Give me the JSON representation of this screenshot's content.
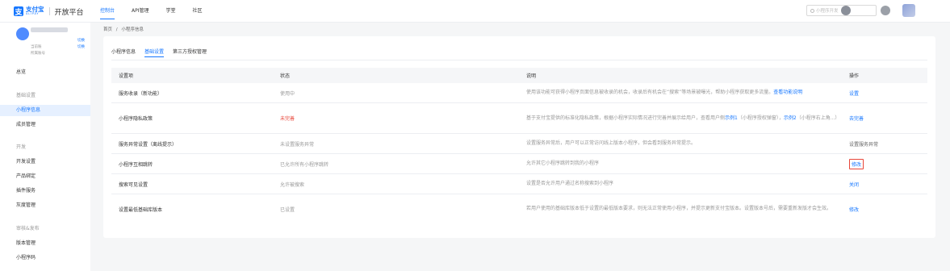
{
  "header": {
    "logo_cn": "支付宝",
    "logo_en": "ALIPAY",
    "platform": "开放平台",
    "nav": [
      "控制台",
      "API管理",
      "学堂",
      "社区"
    ],
    "search_placeholder": "小程序开发"
  },
  "account": {
    "switch_label": "切换",
    "row2_label": "当前账",
    "row3_label": "所属账号"
  },
  "sidebar": {
    "items": [
      {
        "label": "总览",
        "type": "item"
      },
      {
        "label": "基础设置",
        "type": "group"
      },
      {
        "label": "小程序信息",
        "type": "item",
        "active": true
      },
      {
        "label": "成员管理",
        "type": "item"
      },
      {
        "label": "开发",
        "type": "group"
      },
      {
        "label": "开发设置",
        "type": "item"
      },
      {
        "label": "产品绑定",
        "type": "item"
      },
      {
        "label": "插件服务",
        "type": "item"
      },
      {
        "label": "灰度管理",
        "type": "item"
      },
      {
        "label": "审核&发布",
        "type": "group"
      },
      {
        "label": "版本管理",
        "type": "item"
      },
      {
        "label": "小程序码",
        "type": "item"
      }
    ]
  },
  "breadcrumb": {
    "home": "首页",
    "sep": "/",
    "current": "小程序信息"
  },
  "tabs": [
    "小程序信息",
    "基础设置",
    "第三方授权管理"
  ],
  "table": {
    "headers": [
      "设置项",
      "状态",
      "说明",
      "操作"
    ],
    "rows": [
      {
        "name": "服务收录（新功能）",
        "status": "使用中",
        "desc": "使用该功能可获得小程序页面信息被收录的机会，收录后有机会在“搜索”等场景被曝光，帮助小程序获取更多流量。",
        "desc_link": "查看功能说明",
        "action": "设置"
      },
      {
        "name": "小程序隐私政策",
        "status": "未完善",
        "desc": "基于支付宝提供的标准化隐私政策，根据小程序实际情况进行完善并展示给用户，查看用户侧",
        "desc_link": "示例1",
        "desc2": "（小程序授权弹窗），",
        "desc_link2": "示例2",
        "desc3": "（小程序右上角...）",
        "action": "去完善"
      },
      {
        "name": "服务异常设置（离线提示）",
        "status": "未设置服务异常",
        "desc": "设置服务异常后，用户可以正常访问线上版本小程序，但会看到服务异常提示。",
        "action": "设置服务异常"
      },
      {
        "name": "小程序互相跳转",
        "status": "已允许所有小程序跳转",
        "desc": "允许其它小程序跳转到我的小程序",
        "action": "修改"
      },
      {
        "name": "搜索可见设置",
        "status": "允许被搜索",
        "desc": "设置是否允许用户通过名称搜索到小程序",
        "action": "关闭"
      },
      {
        "name": "设置最低基础库版本",
        "status": "已设置",
        "desc": "若用户使用的基础库版本低于设置的最低版本要求，则无法正常使用小程序，并提示更新支付宝版本。设置版本号后，需要重新发版才会生效。",
        "action": "修改"
      }
    ]
  }
}
